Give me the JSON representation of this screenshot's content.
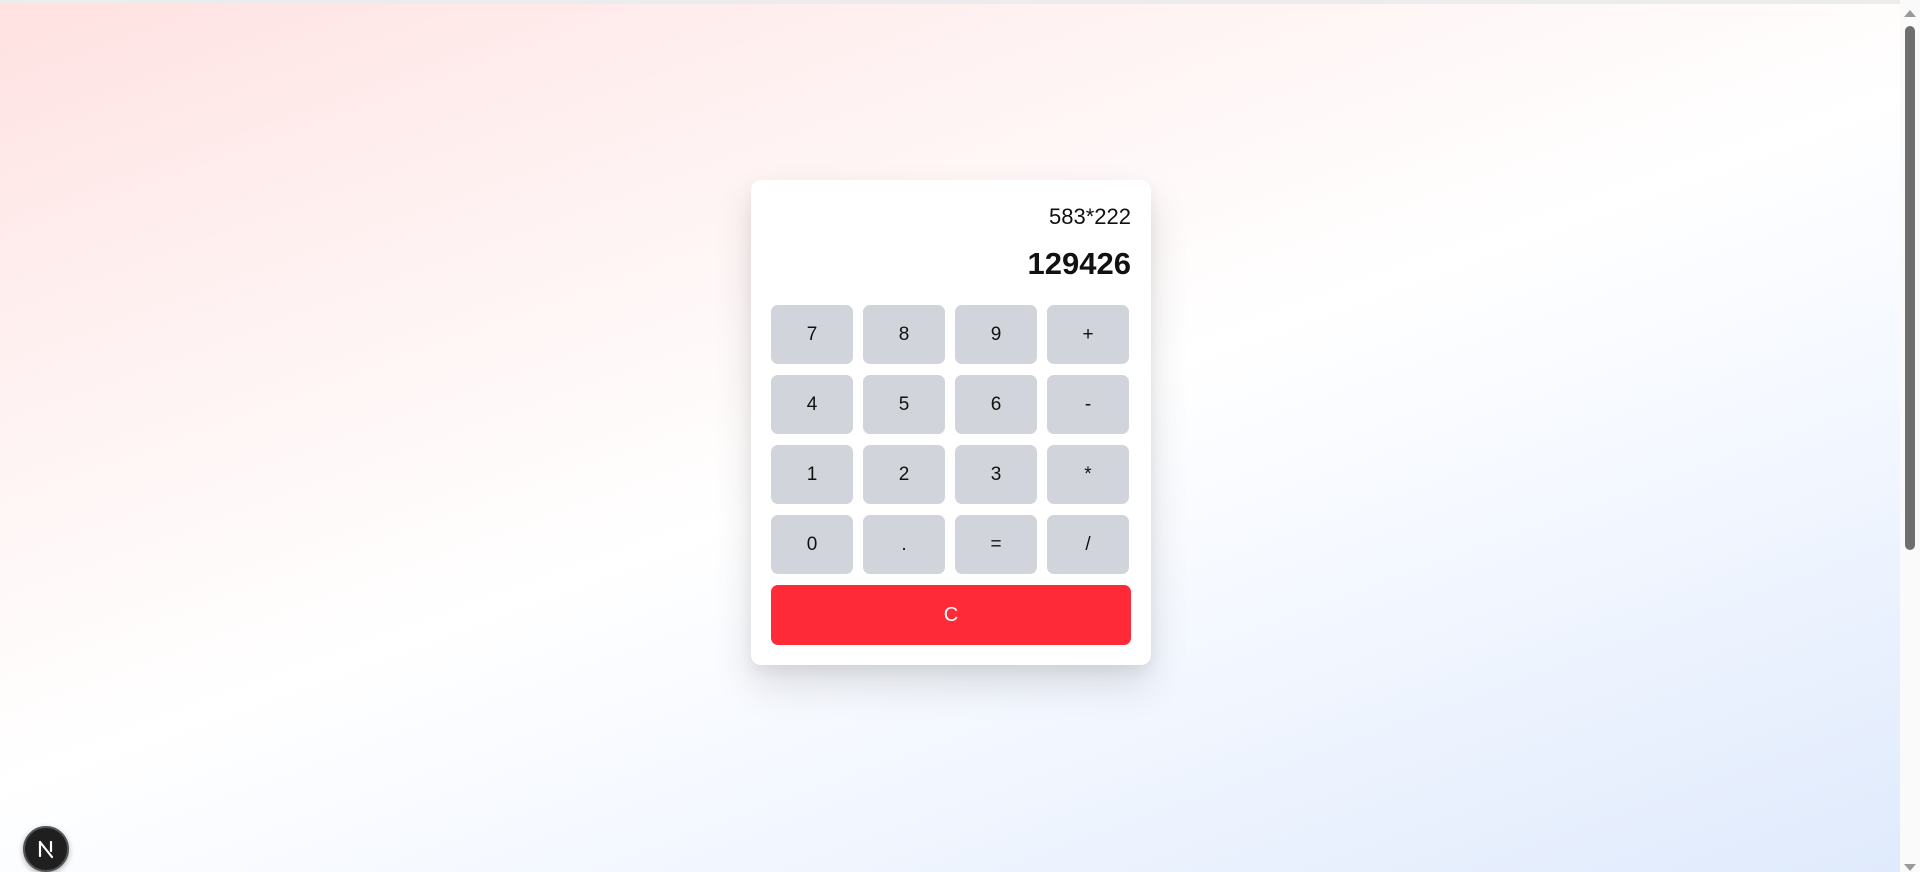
{
  "calculator": {
    "expression": "583*222",
    "result": "129426",
    "keys": [
      {
        "label": "7",
        "name": "key-7"
      },
      {
        "label": "8",
        "name": "key-8"
      },
      {
        "label": "9",
        "name": "key-9"
      },
      {
        "label": "+",
        "name": "key-add"
      },
      {
        "label": "4",
        "name": "key-4"
      },
      {
        "label": "5",
        "name": "key-5"
      },
      {
        "label": "6",
        "name": "key-6"
      },
      {
        "label": "-",
        "name": "key-subtract"
      },
      {
        "label": "1",
        "name": "key-1"
      },
      {
        "label": "2",
        "name": "key-2"
      },
      {
        "label": "3",
        "name": "key-3"
      },
      {
        "label": "*",
        "name": "key-multiply"
      },
      {
        "label": "0",
        "name": "key-0"
      },
      {
        "label": ".",
        "name": "key-decimal"
      },
      {
        "label": "=",
        "name": "key-equals"
      },
      {
        "label": "/",
        "name": "key-divide"
      }
    ],
    "clear_label": "C"
  },
  "colors": {
    "key_background": "#d1d5db",
    "clear_background": "#ff2a38",
    "badge_background": "#1f1f1f"
  },
  "icons": {
    "dev_badge": "nextjs-logo-icon"
  }
}
